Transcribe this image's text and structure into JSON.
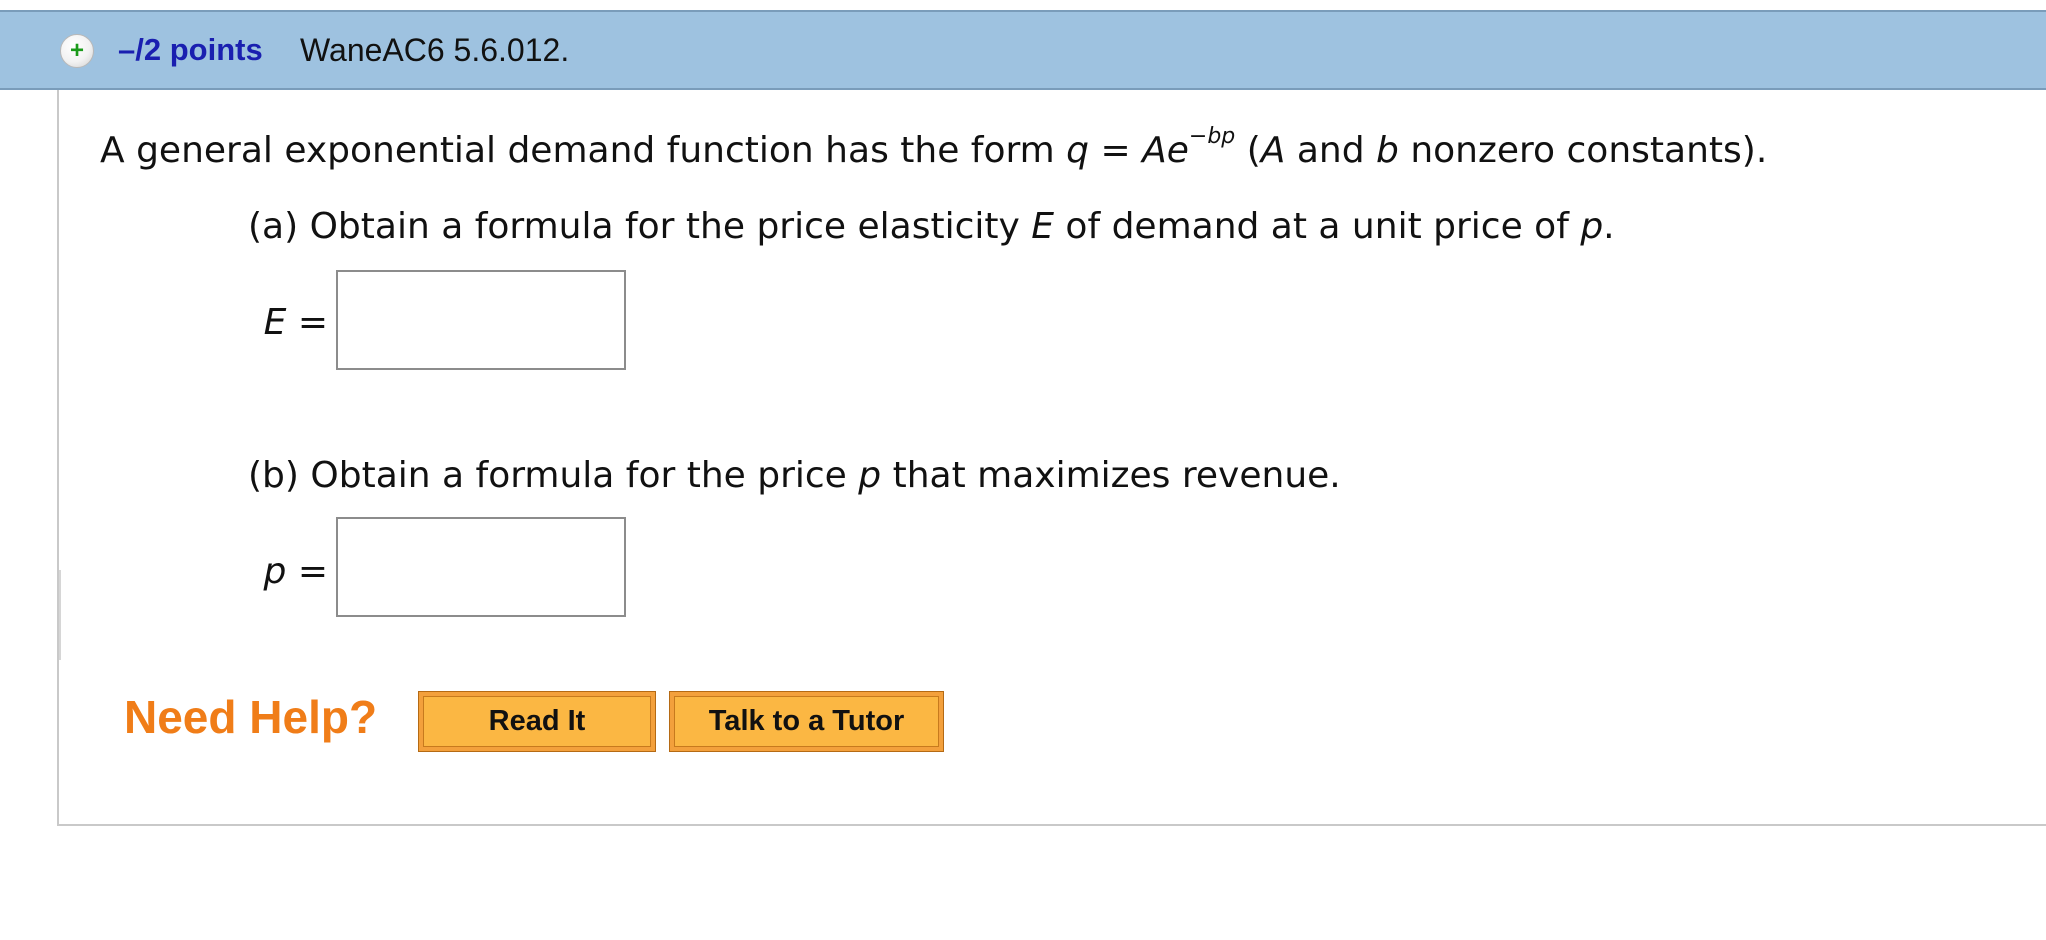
{
  "header": {
    "points": "–/2 points",
    "question_id": "WaneAC6 5.6.012."
  },
  "question": {
    "intro": {
      "prefix": "A general exponential demand function has the form ",
      "q": "q",
      "equals": " = ",
      "A": "A",
      "e": "e",
      "exponent": "−bp",
      "paren_open": " (",
      "A2": "A",
      "and": " and ",
      "b": "b",
      "suffix": " nonzero constants)."
    },
    "part_a": {
      "prefix": "(a) Obtain a formula for the price elasticity ",
      "E": "E",
      "middle": " of demand at a unit price of ",
      "p": "p",
      "suffix": ".",
      "answer_label_var": "E",
      "answer_label_eq": " =",
      "answer_value": ""
    },
    "part_b": {
      "prefix": "(b) Obtain a formula for the price ",
      "p": "p",
      "suffix": " that maximizes revenue.",
      "answer_label_var": "p",
      "answer_label_eq": " =",
      "answer_value": ""
    }
  },
  "help": {
    "label": "Need Help?",
    "read_it": "Read It",
    "talk_to_tutor": "Talk to a Tutor"
  },
  "colors": {
    "header_bg": "#9ec2e0",
    "points_text": "#1a1fb0",
    "need_help": "#f07d18",
    "button_bg": "#fbb743",
    "plus_icon": "#1a9a1a"
  },
  "icons": {
    "expand": "plus-circle-icon"
  }
}
